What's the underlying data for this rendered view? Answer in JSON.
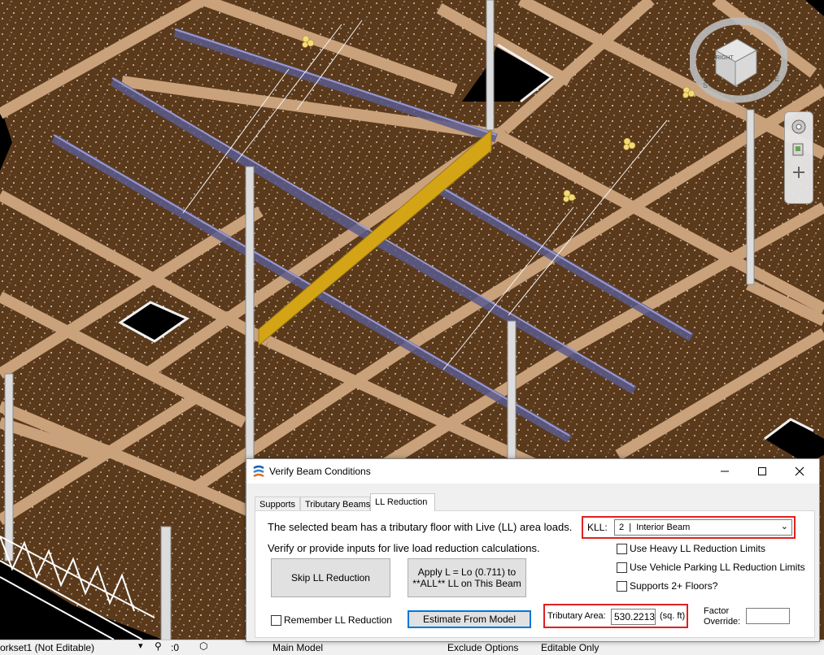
{
  "dialog": {
    "title": "Verify Beam Conditions",
    "tabs": [
      "Supports",
      "Tributary Beams",
      "LL Reduction"
    ],
    "active_tab": "LL Reduction",
    "intro_line1": "The selected beam has a tributary floor with Live (LL) area loads.",
    "intro_line2": "Verify or provide inputs for live load reduction calculations.",
    "kll_label": "KLL:",
    "kll_value": "2  |  Interior Beam",
    "skip_button": "Skip LL Reduction",
    "apply_button_line1": "Apply L = Lo (0.711) to",
    "apply_button_line2": "**ALL** LL on This Beam",
    "heavy_ll_label": "Use Heavy LL Reduction Limits",
    "vehicle_ll_label": "Use Vehicle Parking LL Reduction Limits",
    "supports_floors_label": "Supports 2+ Floors?",
    "remember_label": "Remember LL Reduction",
    "estimate_button": "Estimate From Model",
    "tributary_area_label": "Tributary Area:",
    "tributary_area_value": "530.22136",
    "tributary_area_unit": "(sq. ft)",
    "factor_override_label1": "Factor",
    "factor_override_label2": "Override:",
    "factor_override_value": ""
  },
  "statusbar": {
    "workset": "orkset1 (Not Editable)",
    "selection_count": ":0",
    "model": "Main Model",
    "exclude_options": "Exclude Options",
    "editable_only": "Editable Only"
  },
  "viewcube": {
    "face_label": "RIGHT",
    "compass_e": "E",
    "compass_s": "S"
  },
  "colors": {
    "floor": "#5b3a1c",
    "beam": "#c9a27c",
    "selected_beam": "#d4a417",
    "steel_beam": "#5a5a8c",
    "highlight": "#e02020",
    "button_focus": "#0078d7"
  },
  "icons": [
    "app-logo-icon",
    "minimize-icon",
    "maximize-icon",
    "close-icon",
    "chevron-down-icon",
    "view-cube-icon",
    "steering-wheel-icon",
    "zoom-icon",
    "filter-icon",
    "model-icon"
  ]
}
